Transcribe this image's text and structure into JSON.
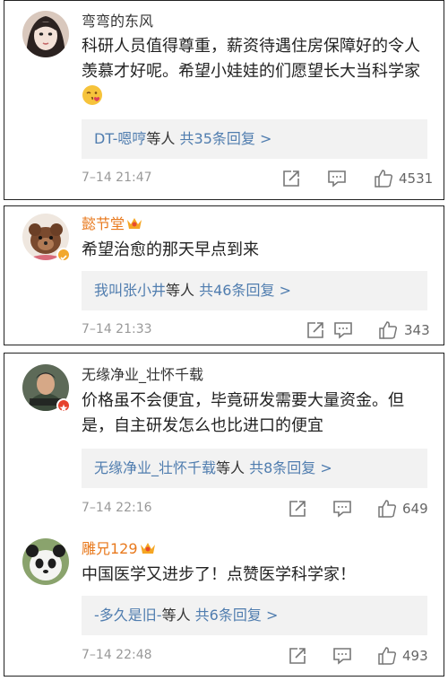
{
  "comments": [
    {
      "username": "弯弯的东风",
      "text": "科研人员值得尊重，薪资待遇住房保障好的令人羡慕才好呢。希望小娃娃的们愿望长大当科学家",
      "reply_users": "DT-嗯哼",
      "reply_mid": "等人",
      "reply_count": "共35条回复 >",
      "time": "7–14 21:47",
      "likes": "4531"
    },
    {
      "username": "懿节堂",
      "text": "希望治愈的那天早点到来",
      "reply_users": "我叫张小井",
      "reply_mid": "等人",
      "reply_count": "共46条回复 >",
      "time": "7–14 21:33",
      "likes": "343"
    },
    {
      "username": "无缘净业_壮怀千载",
      "text": "价格虽不会便宜，毕竟研发需要大量资金。但是，自主研发怎么也比进口的便宜",
      "reply_users": "无缘净业_壮怀千载",
      "reply_mid": "等人",
      "reply_count": "共8条回复 >",
      "time": "7–14 22:16",
      "likes": "649"
    },
    {
      "username": "雕兄129",
      "text": "中国医学又进步了！点赞医学科学家！",
      "reply_users": "-多久是旧-",
      "reply_mid": "等人",
      "reply_count": "共6条回复 >",
      "time": "7–14 22:48",
      "likes": "493"
    }
  ],
  "colors": {
    "username_vip": "#e8791d",
    "link": "#507daf",
    "reply_bg": "#f2f2f2",
    "meta": "#999999"
  },
  "icons": [
    "share-icon",
    "comment-icon",
    "like-icon",
    "crown-icon",
    "emoji-icon"
  ]
}
